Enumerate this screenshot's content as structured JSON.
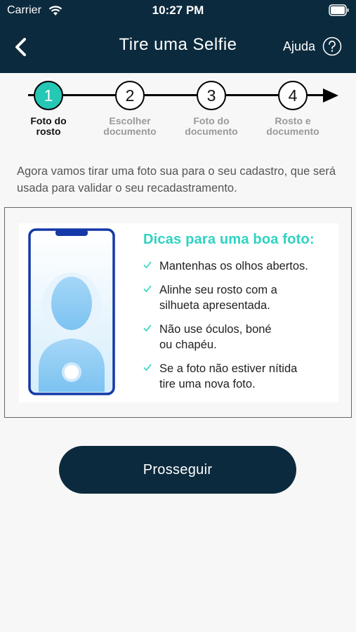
{
  "status_bar": {
    "carrier": "Carrier",
    "time": "10:27 PM"
  },
  "header": {
    "title": "Tire uma Selfie",
    "help_label": "Ajuda"
  },
  "stepper": {
    "steps": [
      {
        "number": "1",
        "label_line1": "Foto do",
        "label_line2": "rosto",
        "active": true
      },
      {
        "number": "2",
        "label_line1": "Escolher",
        "label_line2": "documento",
        "active": false
      },
      {
        "number": "3",
        "label_line1": "Foto do",
        "label_line2": "documento",
        "active": false
      },
      {
        "number": "4",
        "label_line1": "Rosto e",
        "label_line2": "documento",
        "active": false
      }
    ]
  },
  "intro_text": "Agora vamos tirar uma foto sua para o seu cadastro, que será usada para validar o seu recadastramento.",
  "tips": {
    "title": "Dicas para uma boa foto:",
    "items": [
      {
        "line1": "Mantenhas os olhos abertos.",
        "line2": ""
      },
      {
        "line1": "Alinhe seu rosto com a",
        "line2": "silhueta apresentada."
      },
      {
        "line1": "Não use óculos, boné",
        "line2": "ou chapéu."
      },
      {
        "line1": "Se a foto não estiver nítida",
        "line2": "tire uma nova foto."
      }
    ]
  },
  "proceed_button": "Prosseguir",
  "colors": {
    "header_bg": "#0c2a3d",
    "accent": "#25c7b5",
    "tips_title": "#2ed3c2",
    "phone_border": "#1438a8"
  }
}
